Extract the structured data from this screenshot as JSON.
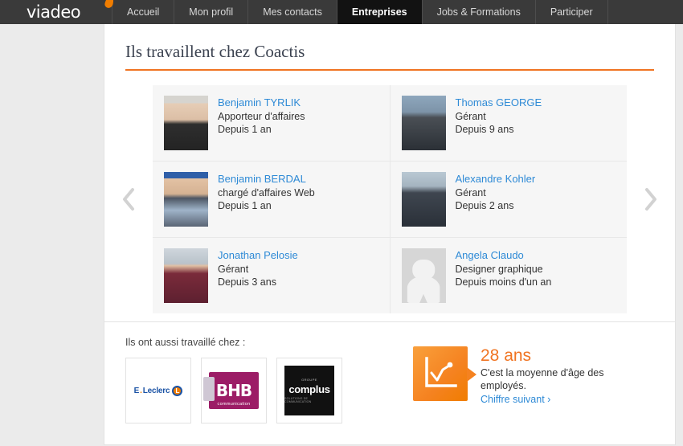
{
  "nav": {
    "logo": "viadeo",
    "items": [
      {
        "label": "Accueil",
        "active": false
      },
      {
        "label": "Mon profil",
        "active": false
      },
      {
        "label": "Mes contacts",
        "active": false
      },
      {
        "label": "Entreprises",
        "active": true
      },
      {
        "label": "Jobs & Formations",
        "active": false
      },
      {
        "label": "Participer",
        "active": false
      }
    ]
  },
  "panel": {
    "title": "Ils travaillent chez Coactis",
    "prev_arrow": "chevron-left",
    "next_arrow": "chevron-right"
  },
  "employees": [
    {
      "name": "Benjamin TYRLIK",
      "role": "Apporteur d'affaires",
      "since": "Depuis 1 an"
    },
    {
      "name": "Thomas GEORGE",
      "role": "Gérant",
      "since": "Depuis 9 ans"
    },
    {
      "name": "Benjamin BERDAL",
      "role": "chargé d'affaires Web",
      "since": "Depuis 1 an"
    },
    {
      "name": "Alexandre Kohler",
      "role": "Gérant",
      "since": "Depuis 2 ans"
    },
    {
      "name": "Jonathan Pelosie",
      "role": "Gérant",
      "since": "Depuis 3 ans"
    },
    {
      "name": "Angela Claudo",
      "role": "Designer graphique",
      "since": "Depuis moins d'un an"
    }
  ],
  "bottom": {
    "also_worked_label": "Ils ont aussi travaillé chez :",
    "companies": [
      {
        "name": "E.Leclerc",
        "text_main": "E",
        "text_dot": ".",
        "text_rest": "Leclerc",
        "mark": "L"
      },
      {
        "name": "BHB communication",
        "letters": "BHB",
        "sub": "communication"
      },
      {
        "name": "complus",
        "top": "GROUPE",
        "main": "complus",
        "bottom": "SOLUTIONS DE COMMUNICATION"
      }
    ]
  },
  "stat": {
    "value": "28 ans",
    "description": "C'est la moyenne d'âge des employés.",
    "link": "Chiffre suivant",
    "link_arrow": "›",
    "icon": "chart-bubble-icon",
    "accent_color": "#f07422",
    "link_color": "#2e8ad6"
  }
}
